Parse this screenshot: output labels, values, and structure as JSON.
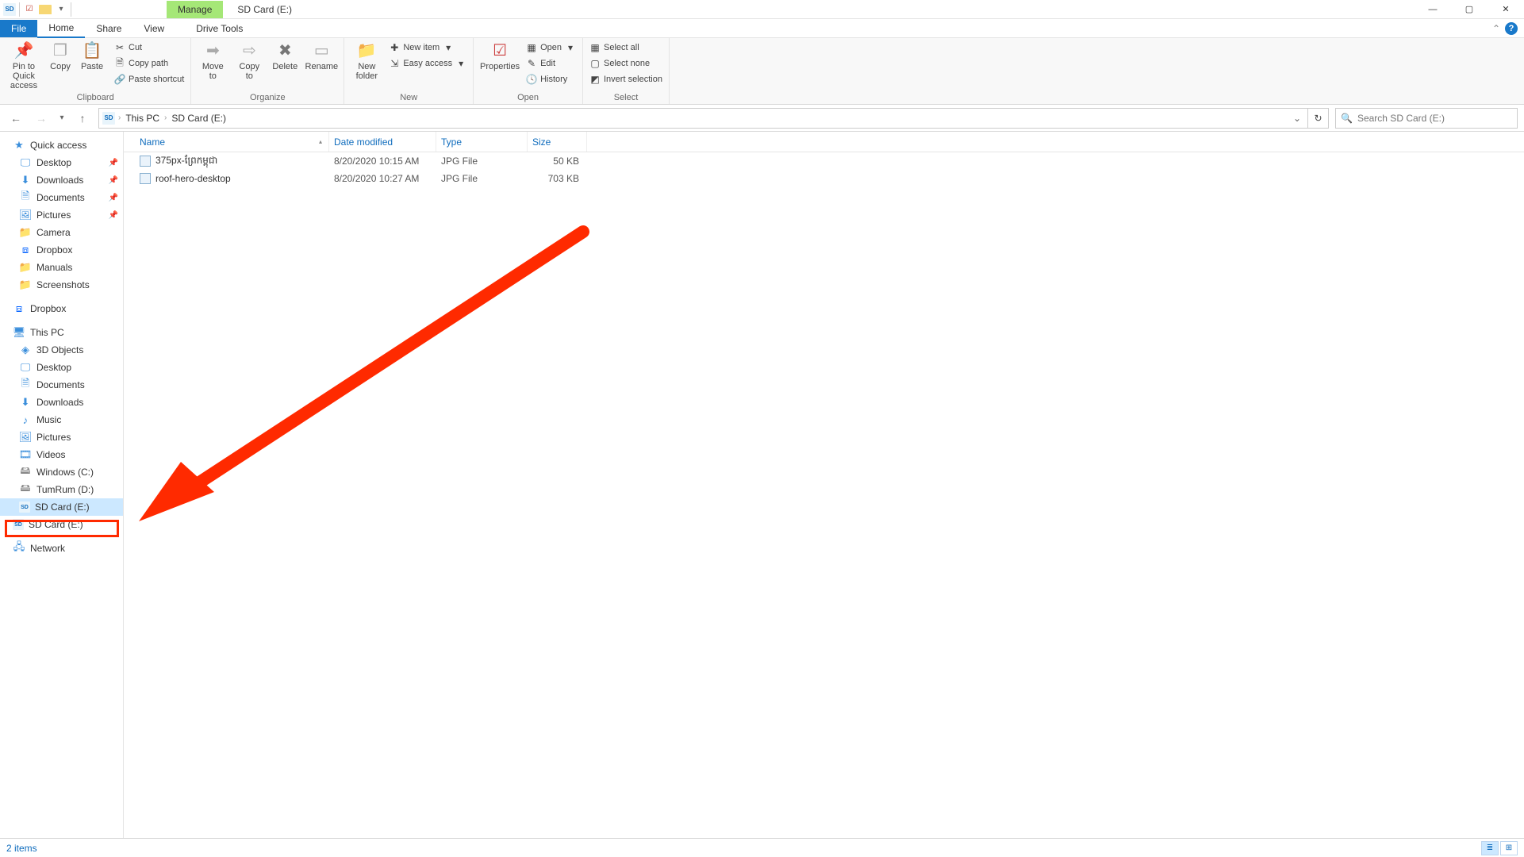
{
  "titlebar": {
    "manage_label": "Manage",
    "window_title": "SD Card (E:)",
    "qat_dropdown": "▾"
  },
  "window_ctrl": {
    "min": "—",
    "max": "▢",
    "close": "✕"
  },
  "ribbon_tabs": {
    "file": "File",
    "home": "Home",
    "share": "Share",
    "view": "View",
    "drive_tools": "Drive Tools"
  },
  "ribbon_collapse_glyph": "⌃",
  "help_glyph": "?",
  "ribbon": {
    "clipboard": {
      "label": "Clipboard",
      "pin": "Pin to Quick access",
      "copy": "Copy",
      "paste": "Paste",
      "cut": "Cut",
      "copy_path": "Copy path",
      "paste_shortcut": "Paste shortcut"
    },
    "organize": {
      "label": "Organize",
      "move_to": "Move to",
      "copy_to": "Copy to",
      "delete": "Delete",
      "rename": "Rename"
    },
    "new": {
      "label": "New",
      "new_folder": "New folder",
      "new_item": "New item",
      "easy_access": "Easy access"
    },
    "open": {
      "label": "Open",
      "properties": "Properties",
      "open": "Open",
      "edit": "Edit",
      "history": "History"
    },
    "select": {
      "label": "Select",
      "select_all": "Select all",
      "select_none": "Select none",
      "invert": "Invert selection"
    }
  },
  "addr": {
    "crumb_pc": "This PC",
    "crumb_sd": "SD Card (E:)",
    "refresh_glyph": "↻"
  },
  "search": {
    "placeholder": "Search SD Card (E:)",
    "icon": "🔍"
  },
  "nav": {
    "quick_access": "Quick access",
    "qa_items": [
      {
        "label": "Desktop",
        "pinned": true
      },
      {
        "label": "Downloads",
        "pinned": true
      },
      {
        "label": "Documents",
        "pinned": true
      },
      {
        "label": "Pictures",
        "pinned": true
      },
      {
        "label": "Camera",
        "pinned": false
      },
      {
        "label": "Dropbox",
        "pinned": false
      },
      {
        "label": "Manuals",
        "pinned": false
      },
      {
        "label": "Screenshots",
        "pinned": false
      }
    ],
    "dropbox": "Dropbox",
    "this_pc": "This PC",
    "pc_items": [
      "3D Objects",
      "Desktop",
      "Documents",
      "Downloads",
      "Music",
      "Pictures",
      "Videos",
      "Windows (C:)",
      "TumRum (D:)",
      "SD Card (E:)",
      "SD Card (E:)"
    ],
    "network": "Network"
  },
  "columns": {
    "name": "Name",
    "date": "Date modified",
    "type": "Type",
    "size": "Size"
  },
  "files": [
    {
      "name": "375px-ព្រែកម្ពុជា",
      "date": "8/20/2020 10:15 AM",
      "type": "JPG File",
      "size": "50 KB"
    },
    {
      "name": "roof-hero-desktop",
      "date": "8/20/2020 10:27 AM",
      "type": "JPG File",
      "size": "703 KB"
    }
  ],
  "status": {
    "items": "2 items"
  }
}
